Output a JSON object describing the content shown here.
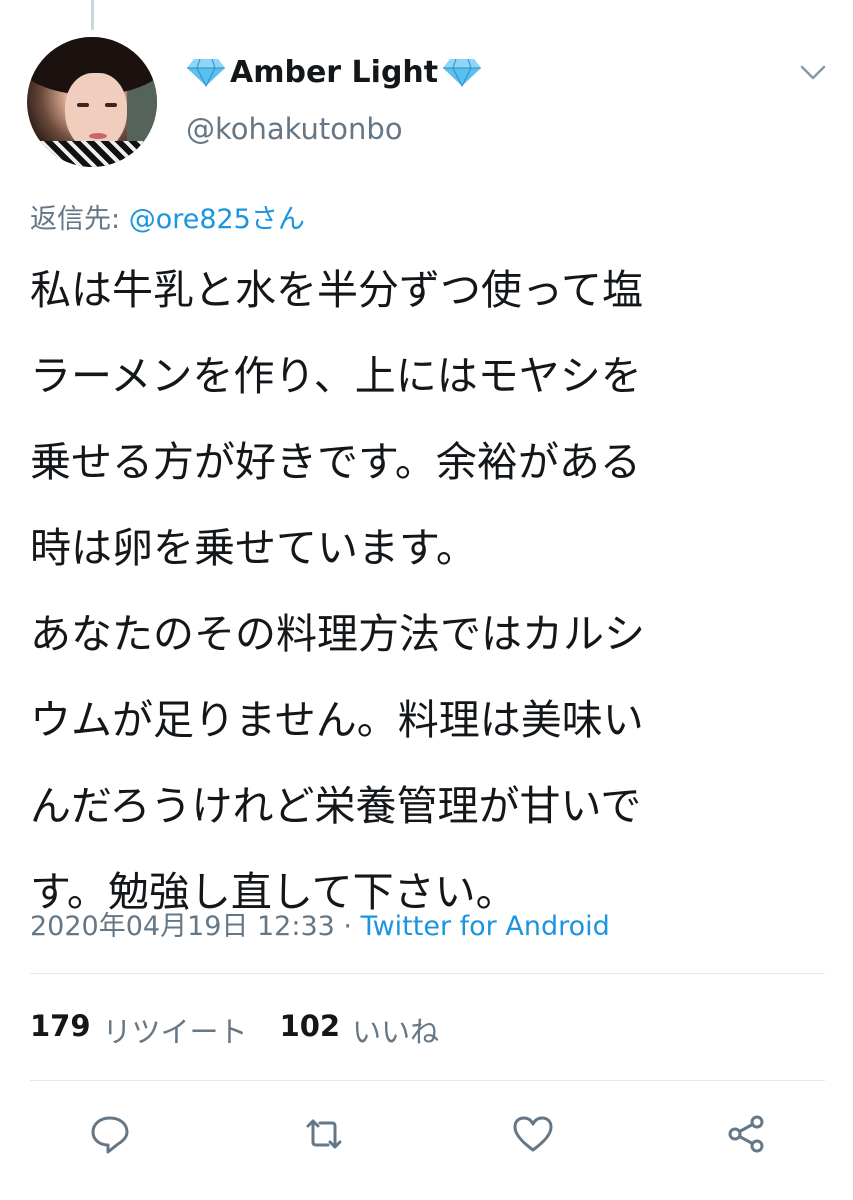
{
  "user": {
    "display_name": "Amber Light",
    "handle": "@kohakutonbo"
  },
  "reply": {
    "prefix": "返信先: ",
    "mention": "@ore825さん"
  },
  "tweet": {
    "lines": [
      "私は牛乳と水を半分ずつ使って塩",
      "ラーメンを作り、上にはモヤシを",
      "乗せる方が好きです。余裕がある",
      "時は卵を乗せています。",
      "あなたのその料理方法ではカルシ",
      "ウムが足りません。料理は美味い",
      "んだろうけれど栄養管理が甘いで",
      "す。勉強し直して下さい。"
    ]
  },
  "meta": {
    "timestamp": "2020年04月19日 12:33",
    "separator": " · ",
    "source": "Twitter for Android"
  },
  "stats": {
    "retweets_count": "179",
    "retweets_label": "リツイート",
    "likes_count": "102",
    "likes_label": "いいね"
  },
  "icons": {
    "name_decoration": "gem-icon",
    "menu": "chevron-down-icon",
    "actions": [
      "reply-icon",
      "retweet-icon",
      "like-icon",
      "share-icon"
    ]
  },
  "colors": {
    "link": "#1b95e0",
    "secondary_text": "#657786",
    "primary_text": "#14171a",
    "gem": "#5bc0f0"
  }
}
